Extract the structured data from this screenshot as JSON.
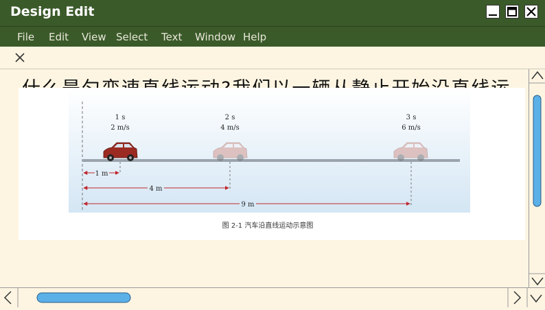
{
  "window": {
    "title": "Design Edit"
  },
  "menu": [
    "File",
    "Edit",
    "View",
    "Select",
    "Text",
    "Window",
    "Help"
  ],
  "document": {
    "heading": "什么是匀变速直线运动?我们以一辆从静止开始沿直线运",
    "figure": {
      "times": [
        "1 s",
        "2 s",
        "3 s"
      ],
      "speeds": [
        "2 m/s",
        "4 m/s",
        "6 m/s"
      ],
      "distances": [
        "1 m",
        "4 m",
        "9 m"
      ],
      "caption": "图 2-1    汽车沿直线运动示意图"
    }
  },
  "colors": {
    "titlebar": "#3b5a2a",
    "scroll_thumb": "#5bb0e8",
    "background": "#fdf5e2"
  }
}
